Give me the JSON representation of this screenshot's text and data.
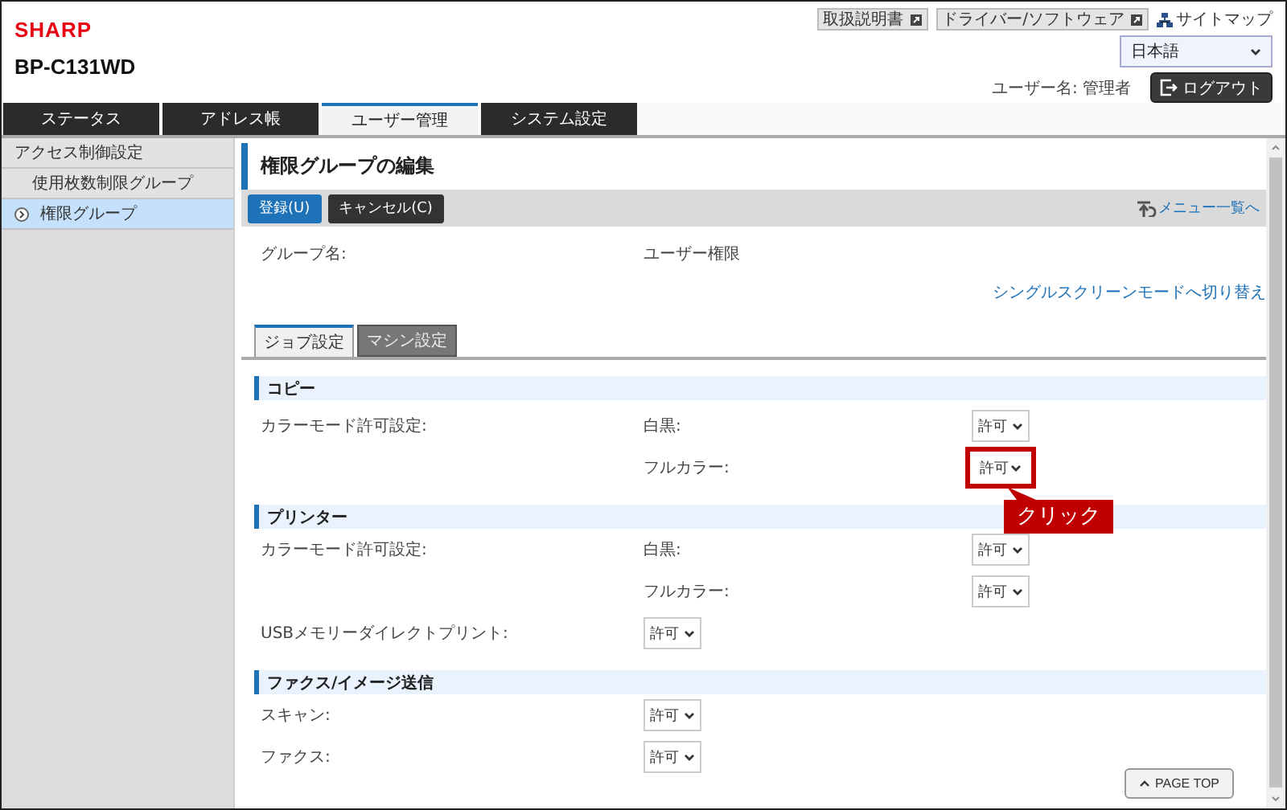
{
  "header": {
    "logo": "SHARP",
    "model": "BP-C131WD",
    "links": [
      {
        "kind": "external",
        "label": "取扱説明書"
      },
      {
        "kind": "external",
        "label": "ドライバー/ソフトウェア"
      },
      {
        "kind": "sitemap",
        "label": "サイトマップ"
      }
    ],
    "language": "日本語",
    "user_label": "ユーザー名: 管理者",
    "logout": "ログアウト"
  },
  "tabs": [
    {
      "label": "ステータス",
      "selected": false
    },
    {
      "label": "アドレス帳",
      "selected": false
    },
    {
      "label": "ユーザー管理",
      "selected": true
    },
    {
      "label": "システム設定",
      "selected": false
    }
  ],
  "sidebar": {
    "items": [
      {
        "label": "アクセス制御設定",
        "selected": false,
        "children": [
          {
            "label": "使用枚数制限グループ",
            "selected": false
          },
          {
            "label": "権限グループ",
            "selected": true
          }
        ]
      }
    ]
  },
  "page": {
    "title": "権限グループの編集",
    "buttons": [
      {
        "label": "登録(U)",
        "kind": "primary"
      },
      {
        "label": "キャンセル(C)",
        "kind": "secondary"
      }
    ],
    "menu_link": "メニュー一覧へ",
    "group_name_label": "グループ名:",
    "group_name": "ユーザー権限",
    "mode_link": "シングルスクリーンモードへ切り替え",
    "subtabs": [
      {
        "label": "ジョブ設定",
        "selected": true
      },
      {
        "label": "マシン設定",
        "selected": false
      }
    ],
    "sections": [
      {
        "title": "コピー",
        "rows": [
          {
            "kind": "pair",
            "label": "カラーモード許可設定:",
            "sublabel": "白黒:",
            "value": "許可",
            "highlighted": false
          },
          {
            "kind": "pair",
            "sublabel": "フルカラー:",
            "value": "許可",
            "highlighted": true,
            "callout": "クリック"
          }
        ]
      },
      {
        "title": "プリンター",
        "rows": [
          {
            "kind": "pair",
            "label": "カラーモード許可設定:",
            "sublabel": "白黒:",
            "value": "許可",
            "highlighted": false
          },
          {
            "kind": "pair",
            "sublabel": "フルカラー:",
            "value": "許可",
            "highlighted": false
          },
          {
            "kind": "single",
            "label": "USBメモリーダイレクトプリント:",
            "value": "許可",
            "highlighted": false
          }
        ]
      },
      {
        "title": "ファクス/イメージ送信",
        "rows": [
          {
            "kind": "single",
            "label": "スキャン:",
            "value": "許可",
            "highlighted": false
          },
          {
            "kind": "single",
            "label": "ファクス:",
            "value": "許可",
            "highlighted": false
          }
        ]
      }
    ],
    "page_top": "PAGE TOP"
  }
}
